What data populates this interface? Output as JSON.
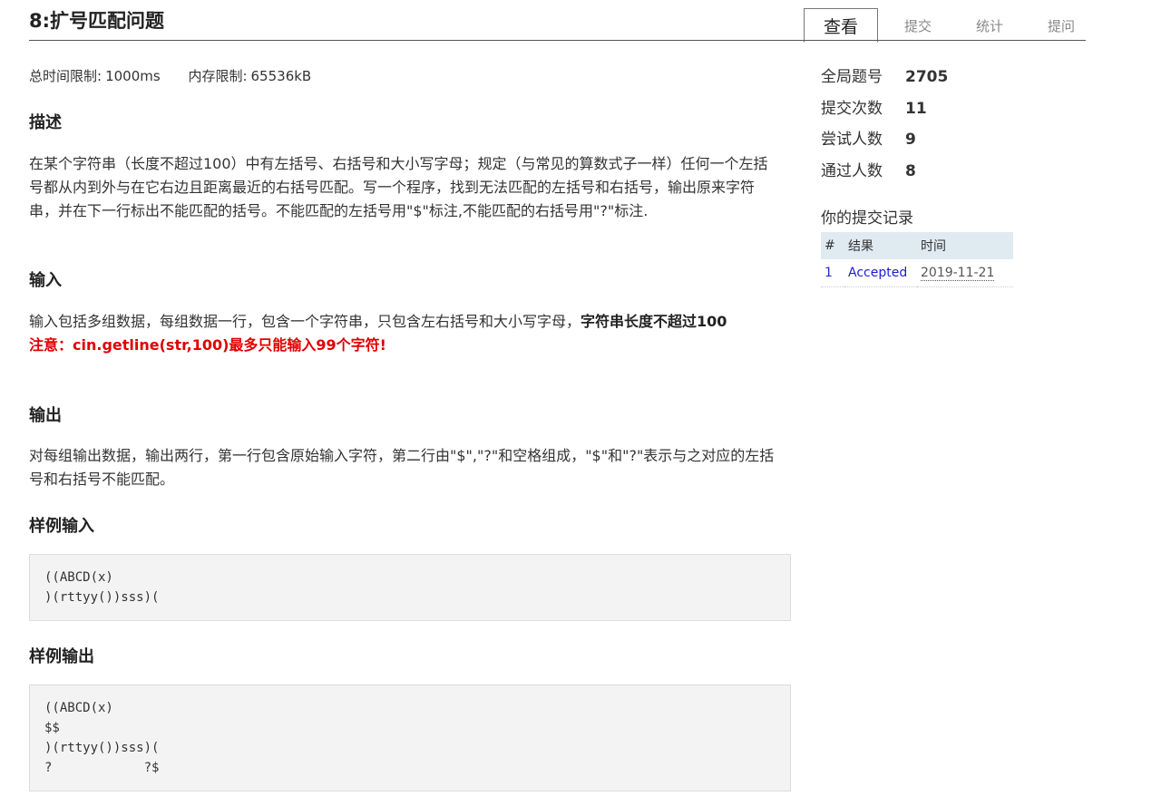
{
  "problem": {
    "title": "8:扩号匹配问题",
    "time_limit_label": "总时间限制:",
    "time_limit": "1000ms",
    "memory_limit_label": "内存限制:",
    "memory_limit": "65536kB"
  },
  "tabs": [
    {
      "label": "查看",
      "active": true
    },
    {
      "label": "提交",
      "active": false
    },
    {
      "label": "统计",
      "active": false
    },
    {
      "label": "提问",
      "active": false
    }
  ],
  "sections": {
    "description_title": "描述",
    "description_text": "在某个字符串（长度不超过100）中有左括号、右括号和大小写字母；规定（与常见的算数式子一样）任何一个左括号都从内到外与在它右边且距离最近的右括号匹配。写一个程序，找到无法匹配的左括号和右括号，输出原来字符串，并在下一行标出不能匹配的括号。不能匹配的左括号用\"$\"标注,不能匹配的右括号用\"?\"标注.",
    "input_title": "输入",
    "input_text": "输入包括多组数据，每组数据一行，包含一个字符串，只包含左右括号和大小写字母，",
    "input_bold": "字符串长度不超过100",
    "input_warning": "注意：cin.getline(str,100)最多只能输入99个字符!",
    "output_title": "输出",
    "output_text": "对每组输出数据，输出两行，第一行包含原始输入字符，第二行由\"$\",\"?\"和空格组成，\"$\"和\"?\"表示与之对应的左括号和右括号不能匹配。",
    "sample_input_title": "样例输入",
    "sample_input": "((ABCD(x)\n)(rttyy())sss)(",
    "sample_output_title": "样例输出",
    "sample_output": "((ABCD(x)\n$$\n)(rttyy())sss)(\n?            ?$"
  },
  "stats": [
    {
      "label": "全局题号",
      "value": "2705"
    },
    {
      "label": "提交次数",
      "value": "11"
    },
    {
      "label": "尝试人数",
      "value": "9"
    },
    {
      "label": "通过人数",
      "value": "8"
    }
  ],
  "records": {
    "title": "你的提交记录",
    "headers": [
      "#",
      "结果",
      "时间"
    ],
    "rows": [
      {
        "num": "1",
        "status": "Accepted",
        "time": "2019-11-21"
      }
    ]
  }
}
